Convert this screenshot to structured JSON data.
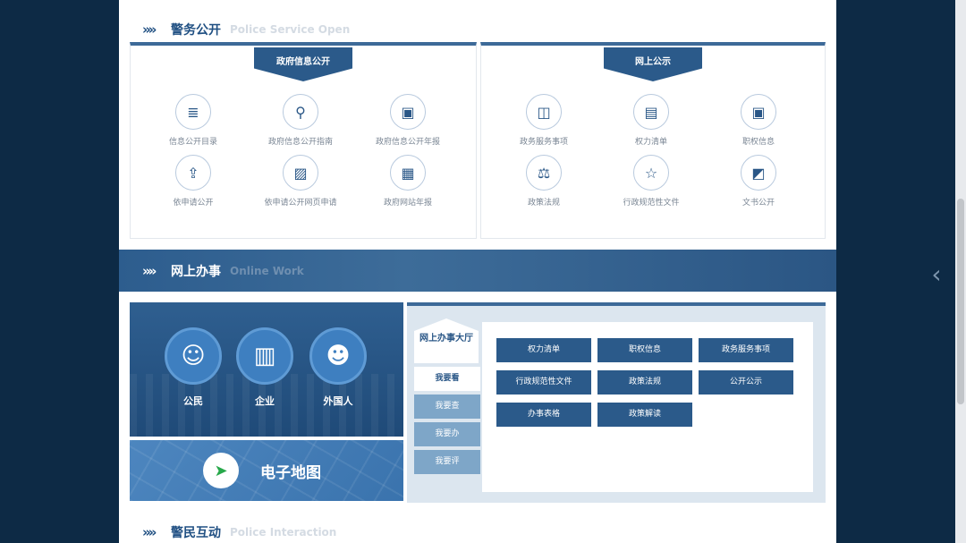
{
  "sections": {
    "police": {
      "icon": "»»",
      "title": "警务公开",
      "en": "Police Service Open"
    },
    "online": {
      "icon": "»»",
      "title": "网上办事",
      "en": "Online Work"
    },
    "interaction": {
      "icon": "»»",
      "title": "警民互动",
      "en": "Police Interaction"
    }
  },
  "gov_panel": {
    "ribbon": "政府信息公开",
    "items": [
      {
        "label": "信息公开目录",
        "icon": "list-icon",
        "glyph": "≣"
      },
      {
        "label": "政府信息公开指南",
        "icon": "location-pin-icon",
        "glyph": "⚲"
      },
      {
        "label": "政府信息公开年报",
        "icon": "report-image-icon",
        "glyph": "▣"
      },
      {
        "label": "依申请公开",
        "icon": "upload-box-icon",
        "glyph": "⇪"
      },
      {
        "label": "依申请公开网页申请",
        "icon": "image-icon",
        "glyph": "▨"
      },
      {
        "label": "政府网站年报",
        "icon": "calendar-icon",
        "glyph": "▦"
      }
    ]
  },
  "notice_panel": {
    "ribbon": "网上公示",
    "items": [
      {
        "label": "政务服务事项",
        "icon": "book-icon",
        "glyph": "◫"
      },
      {
        "label": "权力清单",
        "icon": "document-icon",
        "glyph": "▤"
      },
      {
        "label": "职权信息",
        "icon": "id-card-icon",
        "glyph": "▣"
      },
      {
        "label": "政策法规",
        "icon": "scale-icon",
        "glyph": "⚖"
      },
      {
        "label": "行政规范性文件",
        "icon": "star-icon",
        "glyph": "☆"
      },
      {
        "label": "文书公开",
        "icon": "file-icon",
        "glyph": "◩"
      }
    ]
  },
  "user_types": [
    {
      "label": "公民",
      "icon": "citizen-icon",
      "glyph": "☺"
    },
    {
      "label": "企业",
      "icon": "briefcase-icon",
      "glyph": "▥"
    },
    {
      "label": "外国人",
      "icon": "foreigner-icon",
      "glyph": "☻"
    }
  ],
  "map": {
    "label": "电子地图",
    "icon": "navigation-arrow-icon",
    "glyph": "➤"
  },
  "hall": {
    "title": "网上办事大厅"
  },
  "tabs": [
    "我要看",
    "我要查",
    "我要办",
    "我要评"
  ],
  "active_tab": 0,
  "buttons": [
    "权力清单",
    "职权信息",
    "政务服务事项",
    "行政规范性文件",
    "政策法规",
    "公开公示",
    "办事表格",
    "政策解读"
  ],
  "nav": {
    "side_arrow": "‹"
  },
  "colors": {
    "page_bg": "#0d2a45",
    "primary": "#2b5a8a",
    "band": "#3d6c99"
  }
}
